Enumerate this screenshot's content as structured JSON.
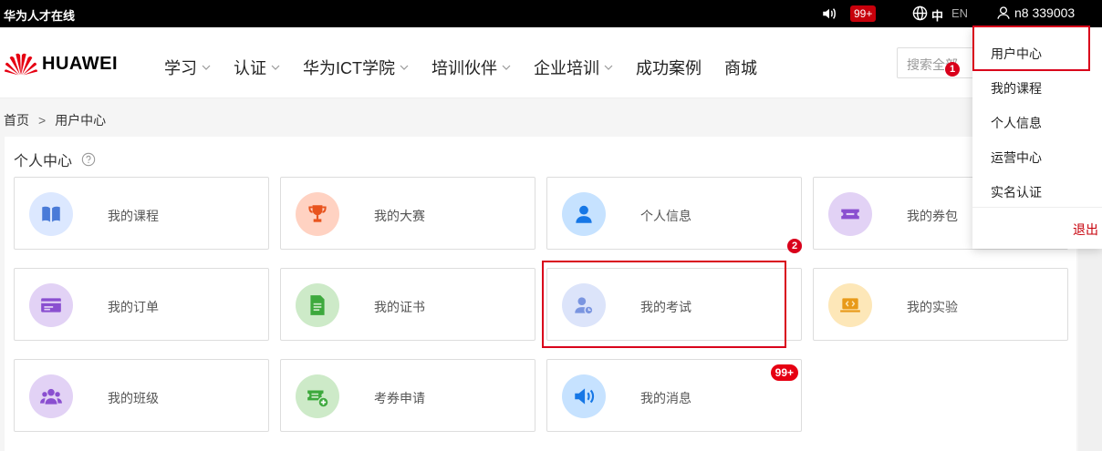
{
  "topbar": {
    "site_title": "华为人才在线",
    "notification_badge": "99+",
    "lang_zh": "中",
    "lang_en": "EN",
    "username": "n8 339003"
  },
  "header": {
    "logo_text": "HUAWEI",
    "nav": [
      {
        "label": "学习",
        "dropdown": true
      },
      {
        "label": "认证",
        "dropdown": true
      },
      {
        "label": "华为ICT学院",
        "dropdown": true
      },
      {
        "label": "培训伙伴",
        "dropdown": true
      },
      {
        "label": "企业培训",
        "dropdown": true
      },
      {
        "label": "成功案例",
        "dropdown": false
      },
      {
        "label": "商城",
        "dropdown": false
      }
    ],
    "search_placeholder": "搜索全部"
  },
  "breadcrumb": {
    "home": "首页",
    "separator": ">",
    "current": "用户中心"
  },
  "content": {
    "title": "个人中心",
    "cards": [
      {
        "label": "我的课程",
        "icon": "book-icon",
        "bg": "#dce8ff",
        "fg": "#4a7bd8"
      },
      {
        "label": "我的大赛",
        "icon": "trophy-icon",
        "bg": "#ffd2c2",
        "fg": "#e8541e"
      },
      {
        "label": "个人信息",
        "icon": "person-icon",
        "bg": "#c6e2ff",
        "fg": "#1677e6"
      },
      {
        "label": "我的券包",
        "icon": "ticket-icon",
        "bg": "#e2d2f5",
        "fg": "#8a4fd0"
      },
      {
        "label": "我的订单",
        "icon": "card-icon",
        "bg": "#e2d2f5",
        "fg": "#8a4fd0"
      },
      {
        "label": "我的证书",
        "icon": "certificate-icon",
        "bg": "#cdeac8",
        "fg": "#3da93d"
      },
      {
        "label": "我的考试",
        "icon": "exam-icon",
        "bg": "#dce4fa",
        "fg": "#7a95e0"
      },
      {
        "label": "我的实验",
        "icon": "laptop-icon",
        "bg": "#fde7b8",
        "fg": "#e89a1a"
      },
      {
        "label": "我的班级",
        "icon": "group-icon",
        "bg": "#e2d2f5",
        "fg": "#8a4fd0"
      },
      {
        "label": "考券申请",
        "icon": "voucher-add-icon",
        "bg": "#cdeac8",
        "fg": "#3da93d"
      },
      {
        "label": "我的消息",
        "icon": "speaker-icon",
        "bg": "#c6e2ff",
        "fg": "#1677e6",
        "badge": "99+"
      }
    ]
  },
  "dropdown": {
    "items": [
      "用户中心",
      "我的课程",
      "个人信息",
      "运营中心",
      "实名认证"
    ],
    "logout": "退出"
  },
  "annotations": [
    "1",
    "2"
  ]
}
